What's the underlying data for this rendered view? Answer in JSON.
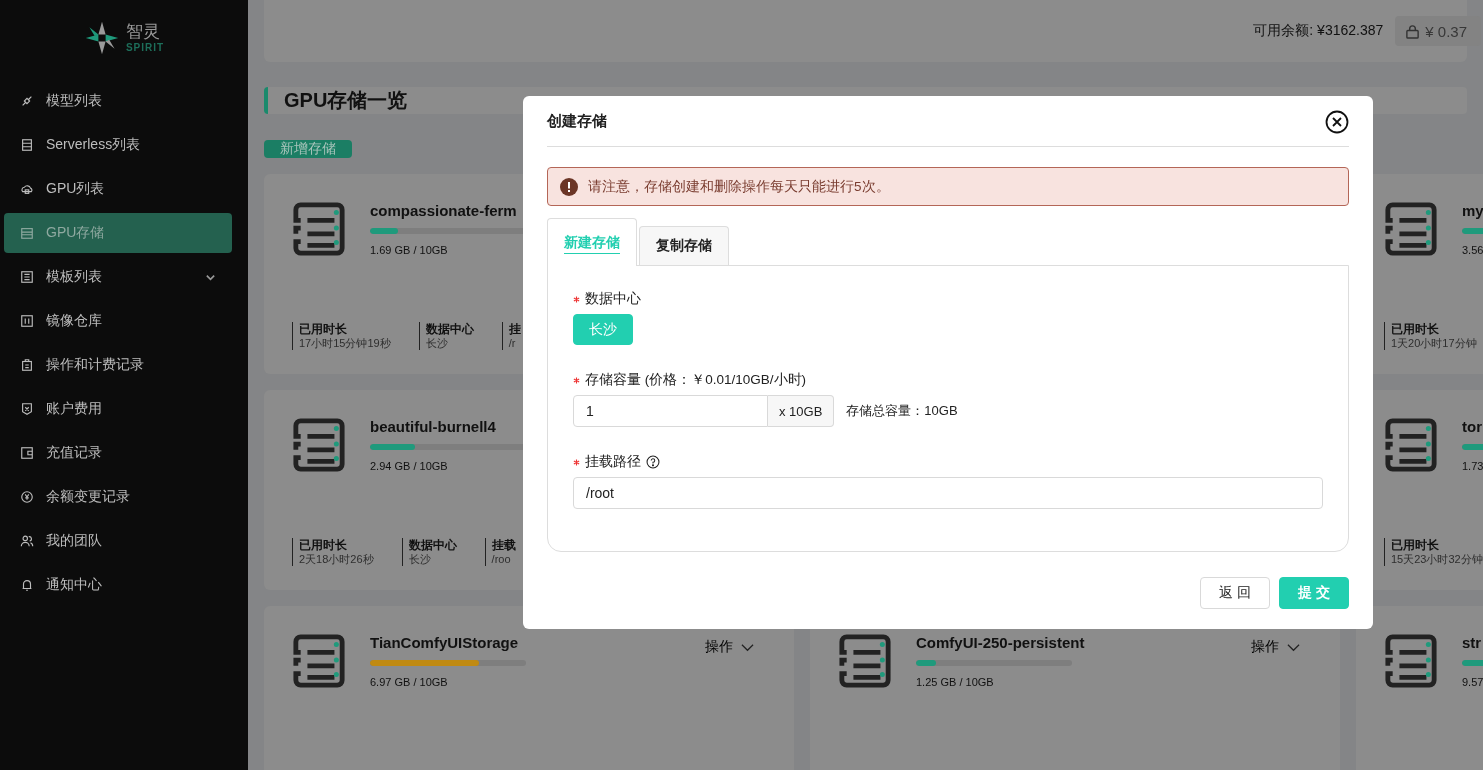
{
  "sidebar": {
    "logo": {
      "name": "智灵",
      "subtitle": "SPIRIT"
    },
    "items": [
      {
        "label": "模型列表",
        "selected": false
      },
      {
        "label": "Serverless列表",
        "selected": false
      },
      {
        "label": "GPU列表",
        "selected": false
      },
      {
        "label": "GPU存储",
        "selected": true
      },
      {
        "label": "模板列表",
        "selected": false,
        "expandable": true
      },
      {
        "label": "镜像仓库",
        "selected": false
      },
      {
        "label": "操作和计费记录",
        "selected": false
      },
      {
        "label": "账户费用",
        "selected": false
      },
      {
        "label": "充值记录",
        "selected": false
      },
      {
        "label": "余额变更记录",
        "selected": false
      },
      {
        "label": "我的团队",
        "selected": false
      },
      {
        "label": "通知中心",
        "selected": false
      }
    ]
  },
  "header": {
    "balance": "可用余额: ¥3162.387",
    "frozen": "¥ 0.37"
  },
  "page_title": "GPU存储一览",
  "add_button": "新增存储",
  "card_rows": [
    {
      "cards": [
        {
          "name": "compassionate-ferm",
          "level": 0.18,
          "color": "#1f9a7c",
          "usage": "1.69 GB / 10GB",
          "stats": [
            {
              "label": "已用时长",
              "value": "17小时15分钟19秒"
            },
            {
              "label": "数据中心",
              "value": "长沙"
            },
            {
              "label": "挂",
              "value": "/r"
            }
          ]
        },
        {
          "name": "my",
          "level": 0.36,
          "color": "#1f9a7c",
          "usage": "3.56",
          "stats": [
            {
              "label": "已用时长",
              "value": "1天20小时17分钟"
            }
          ]
        }
      ]
    },
    {
      "cards": [
        {
          "name": "beautiful-burnell4",
          "level": 0.29,
          "color": "#1f9a7c",
          "usage": "2.94 GB / 10GB",
          "stats": [
            {
              "label": "已用时长",
              "value": "2天18小时26秒"
            },
            {
              "label": "数据中心",
              "value": "长沙"
            },
            {
              "label": "挂载",
              "value": "/roo"
            }
          ]
        },
        {
          "name": "tor",
          "level": 0.17,
          "color": "#1f9a7c",
          "usage": "1.73",
          "stats": [
            {
              "label": "已用时长",
              "value": "15天23小时32分钟"
            }
          ]
        }
      ]
    },
    {
      "cards": [
        {
          "name": "TianComfyUIStorage",
          "level": 0.7,
          "color": "#c08a12",
          "usage": "6.97 GB / 10GB",
          "action": "操作"
        },
        {
          "name": "ComfyUI-250-persistent",
          "level": 0.13,
          "color": "#1f9a7c",
          "usage": "1.25 GB / 10GB",
          "action": "操作"
        },
        {
          "name": "str",
          "level": 0.96,
          "color": "#1f9a7c",
          "usage": "9.57"
        }
      ]
    }
  ],
  "dialog": {
    "title": "创建存储",
    "alert": "请注意，存储创建和删除操作每天只能进行5次。",
    "tabs": [
      {
        "label": "新建存储",
        "selected": true
      },
      {
        "label": "复制存储",
        "selected": false
      }
    ],
    "fields": [
      {
        "kind": "chips",
        "label": "数据中心",
        "required": true,
        "options": [
          {
            "label": "长沙",
            "selected": true
          }
        ]
      },
      {
        "kind": "capacity",
        "label": "存储容量 (价格：￥0.01/10GB/小时)",
        "required": true,
        "value": "1",
        "suffix": "x 10GB",
        "note": "存储总容量：10GB"
      },
      {
        "kind": "text",
        "label": "挂载路径",
        "required": true,
        "help": true,
        "value": "/root"
      }
    ],
    "buttons": [
      {
        "label": "返 回",
        "primary": false
      },
      {
        "label": "提 交",
        "primary": true
      }
    ]
  }
}
